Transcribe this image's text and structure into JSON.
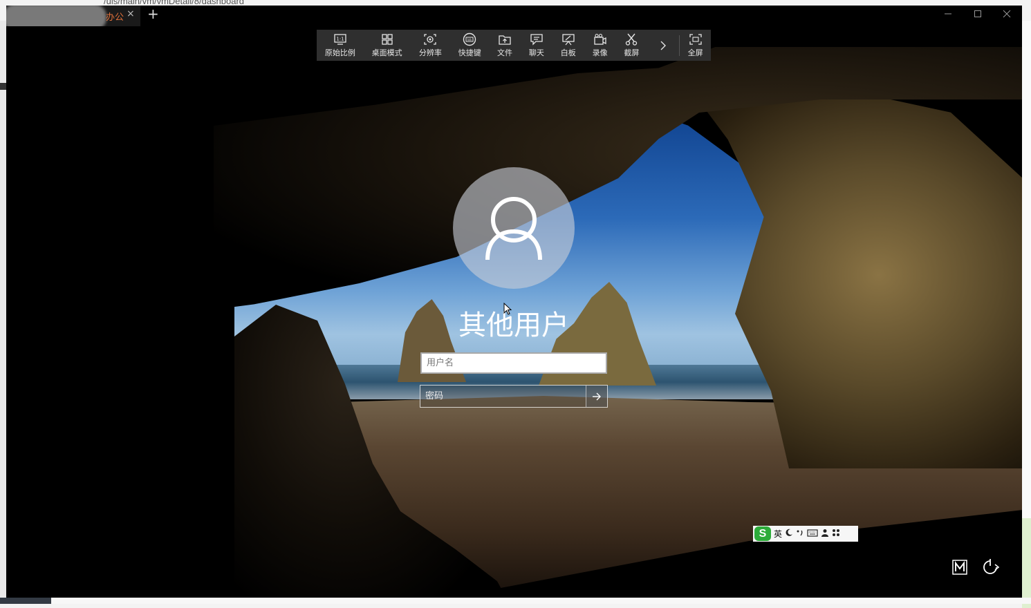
{
  "background_page": {
    "url_fragment": "/uis/main/vm/vmDetail/8/dashboard"
  },
  "window": {
    "tab_title": "办公",
    "tab_close": "×",
    "new_tab": "+"
  },
  "toolbar": {
    "items": [
      {
        "label": "原始比例",
        "icon": "original-ratio-icon"
      },
      {
        "label": "桌面模式",
        "icon": "desktop-mode-icon"
      },
      {
        "label": "分辨率",
        "icon": "resolution-icon"
      },
      {
        "label": "快捷键",
        "icon": "keyboard-icon"
      },
      {
        "label": "文件",
        "icon": "file-upload-icon"
      },
      {
        "label": "聊天",
        "icon": "chat-icon"
      },
      {
        "label": "白板",
        "icon": "whiteboard-icon"
      },
      {
        "label": "录像",
        "icon": "record-icon"
      },
      {
        "label": "截屏",
        "icon": "scissors-icon"
      },
      {
        "label": "全屏",
        "icon": "fullscreen-icon"
      }
    ]
  },
  "login": {
    "user_name": "其他用户",
    "username_placeholder": "用户名",
    "password_placeholder": "密码"
  },
  "ime": {
    "mode": "英"
  },
  "colors": {
    "toolbar_bg": "#2f2f2f",
    "tab_title": "#e0703a",
    "ime_green": "#2dac3a"
  }
}
